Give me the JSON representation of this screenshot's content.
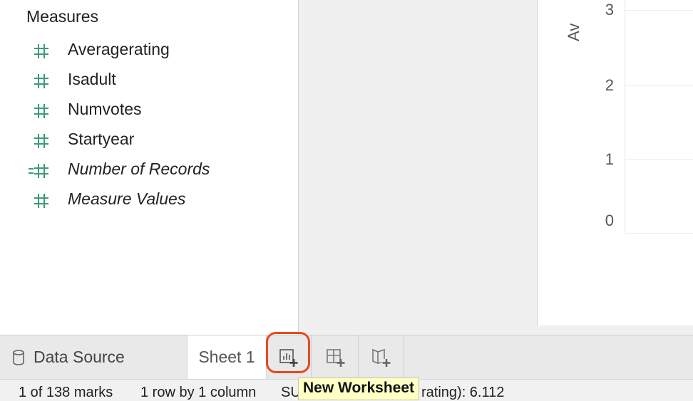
{
  "data_pane": {
    "section_title": "Measures",
    "measures": [
      {
        "label": "Averagerating",
        "icon": "number-measure-icon",
        "italic": false
      },
      {
        "label": "Isadult",
        "icon": "number-measure-icon",
        "italic": false
      },
      {
        "label": "Numvotes",
        "icon": "number-measure-icon",
        "italic": false
      },
      {
        "label": "Startyear",
        "icon": "number-measure-icon",
        "italic": false
      },
      {
        "label": "Number of Records",
        "icon": "calculated-number-measure-icon",
        "italic": true
      },
      {
        "label": "Measure Values",
        "icon": "number-measure-icon",
        "italic": true
      }
    ]
  },
  "view": {
    "axis_title_partial": "Av",
    "y_ticks": [
      "3",
      "2",
      "1",
      "0"
    ]
  },
  "tabs": {
    "data_source": "Data Source",
    "sheet1": "Sheet 1",
    "new_worksheet_icon": "new-worksheet-icon",
    "new_dashboard_icon": "new-dashboard-icon",
    "new_story_icon": "new-story-icon"
  },
  "tooltip": {
    "text": "New Worksheet"
  },
  "status_bar": {
    "marks": "1 of 138 marks",
    "rows_cols": "1 row by 1 column",
    "sum_prefix": "SU",
    "sum_suffix": "rating): 6.112"
  },
  "colors": {
    "measure_icon": "#3c9b73",
    "highlight": "#e8491d",
    "tooltip_bg": "#ffffc6"
  }
}
